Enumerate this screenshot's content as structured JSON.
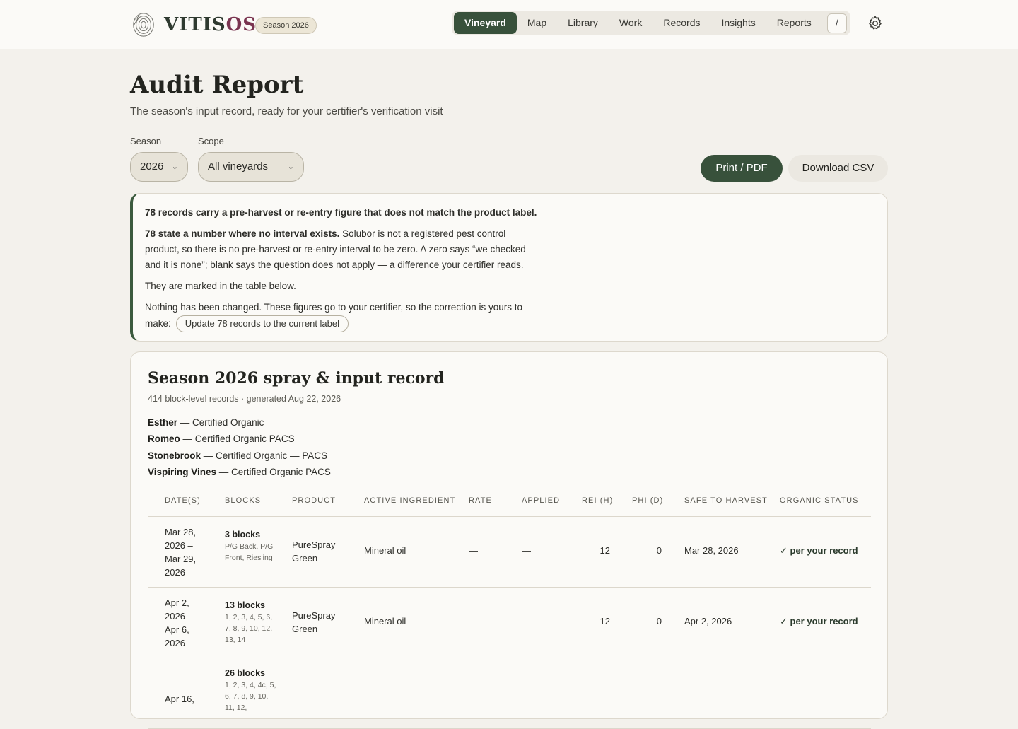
{
  "app": {
    "brand_prefix": "VITIS",
    "brand_suffix": "OS",
    "season_badge": "Season 2026",
    "nav": [
      "Vineyard",
      "Map",
      "Library",
      "Work",
      "Records",
      "Insights",
      "Reports"
    ],
    "nav_active": "Vineyard",
    "command_key": "/"
  },
  "page": {
    "title": "Audit Report",
    "subtitle": "The season's input record, ready for your certifier's verification visit"
  },
  "filters": {
    "season_label": "Season",
    "season_value": "2026",
    "scope_label": "Scope",
    "scope_value": "All vineyards"
  },
  "actions": {
    "print": "Print / PDF",
    "download": "Download CSV"
  },
  "alert": {
    "headline": "78 records carry a pre-harvest or re-entry figure that does not match the product label.",
    "detail_bold": "78 state a number where no interval exists.",
    "detail_text": " Solubor is not a registered pest control product, so there is no pre-harvest or re-entry interval to be zero. A zero says “we checked and it is none”; blank says the question does not apply — a difference your certifier reads.",
    "marked": "They are marked in the table below.",
    "nothing_changed": "Nothing has been changed. These figures go to your certifier, so the correction is yours to make:",
    "fix_button": "Update 78 records to the current label"
  },
  "record": {
    "title": "Season 2026 spray & input record",
    "meta": "414 block-level records · generated Aug 22, 2026",
    "certifications": [
      {
        "vineyard": "Esther",
        "status": " — Certified Organic"
      },
      {
        "vineyard": "Romeo",
        "status": " — Certified Organic PACS"
      },
      {
        "vineyard": "Stonebrook",
        "status": " — Certified Organic — PACS"
      },
      {
        "vineyard": "Vispiring Vines",
        "status": " — Certified Organic PACS"
      }
    ],
    "columns": [
      "DATE(S)",
      "BLOCKS",
      "PRODUCT",
      "ACTIVE INGREDIENT",
      "RATE",
      "APPLIED",
      "REI (H)",
      "PHI (D)",
      "SAFE TO HARVEST",
      "ORGANIC STATUS"
    ],
    "rows": [
      {
        "date": "Mar 28, 2026 – Mar 29, 2026",
        "blocks_count": "3 blocks",
        "blocks_list": "P/G Back, P/G Front, Riesling",
        "product": "PureSpray Green",
        "ingredient": "Mineral oil",
        "rate": "—",
        "applied": "—",
        "rei": "12",
        "phi": "0",
        "safe": "Mar 28, 2026",
        "status": "✓ per your record"
      },
      {
        "date": "Apr 2, 2026 – Apr 6, 2026",
        "blocks_count": "13 blocks",
        "blocks_list": "1, 2, 3, 4, 5, 6, 7, 8, 9, 10, 12, 13, 14",
        "product": "PureSpray Green",
        "ingredient": "Mineral oil",
        "rate": "—",
        "applied": "—",
        "rei": "12",
        "phi": "0",
        "safe": "Apr 2, 2026",
        "status": "✓ per your record"
      },
      {
        "date": "Apr 16,",
        "blocks_count": "26 blocks",
        "blocks_list": "1, 2, 3, 4, 4c, 5, 6, 7, 8, 9, 10, 11, 12,",
        "product": "",
        "ingredient": "",
        "rate": "",
        "applied": "",
        "rei": "",
        "phi": "",
        "safe": "",
        "status": ""
      }
    ]
  }
}
